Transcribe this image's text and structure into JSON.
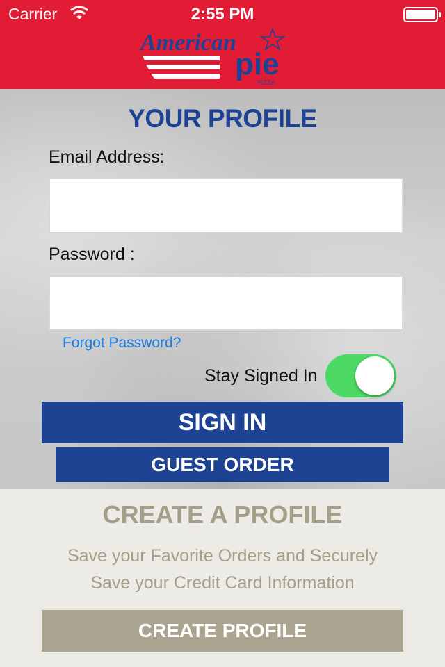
{
  "status_bar": {
    "carrier": "Carrier",
    "time": "2:55 PM",
    "battery_level": 1.0
  },
  "brand": {
    "name_top": "American",
    "name_bottom": "pie",
    "tagline": "PIZZA",
    "colors": {
      "red": "#e31c36",
      "blue": "#1f4393"
    }
  },
  "login": {
    "title": "YOUR PROFILE",
    "email_label": "Email Address:",
    "email_value": "",
    "password_label": "Password :",
    "password_value": "",
    "forgot_link": "Forgot Password?",
    "stay_signed_in_label": "Stay Signed In",
    "stay_signed_in": true,
    "sign_in_button": "SIGN IN",
    "guest_order_button": "GUEST ORDER"
  },
  "create_profile": {
    "title": "CREATE A PROFILE",
    "line1": "Save your Favorite Orders and Securely",
    "line2": "Save your Credit Card Information",
    "button": "CREATE PROFILE"
  }
}
